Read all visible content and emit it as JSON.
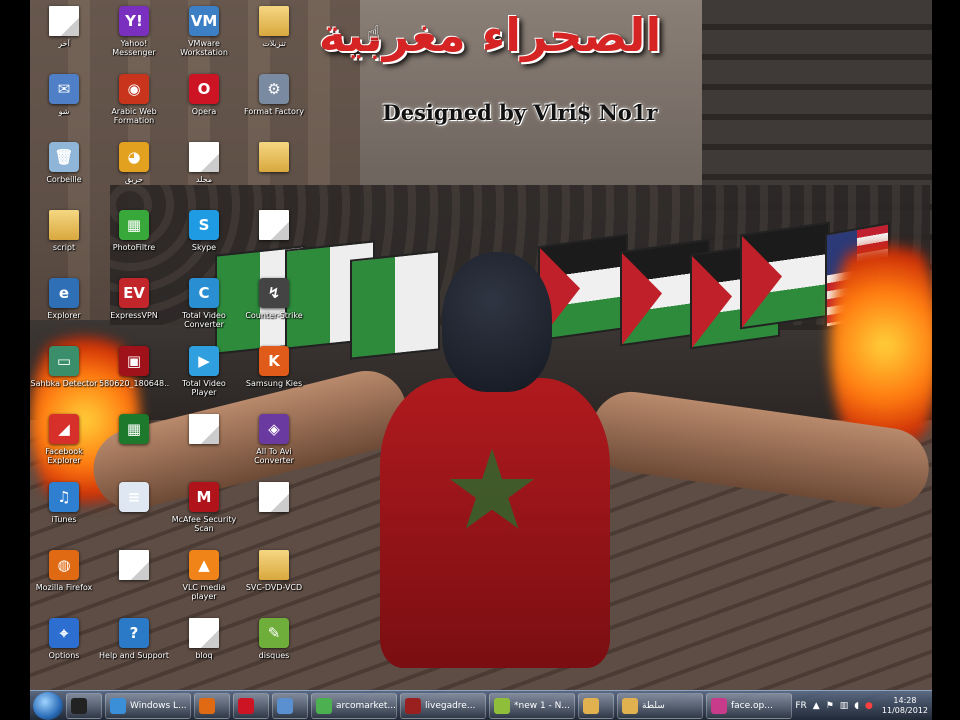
{
  "wallpaper": {
    "title_arabic": "الصحراء مغربية",
    "title_credit": "Designed by Vlri$ No1r"
  },
  "desktop_icons": [
    {
      "label": "آخر",
      "glyph": "",
      "color": "#ffffff",
      "kind": "doc"
    },
    {
      "label": "Yahoo! Messenger",
      "glyph": "Y!",
      "color": "#7b2fbf",
      "kind": "app"
    },
    {
      "label": "VMware Workstation",
      "glyph": "VM",
      "color": "#3c7fc4",
      "kind": "app"
    },
    {
      "label": "تنزيلات",
      "glyph": "",
      "color": "#e0b14e",
      "kind": "folder"
    },
    {
      "label": "شو",
      "glyph": "✉",
      "color": "#4f7fc7",
      "kind": "app"
    },
    {
      "label": "Arabic Web Formation",
      "glyph": "◉",
      "color": "#c8341c",
      "kind": "app"
    },
    {
      "label": "Opera",
      "glyph": "O",
      "color": "#cc1424",
      "kind": "app"
    },
    {
      "label": "Format Factory",
      "glyph": "⚙",
      "color": "#7a8aa0",
      "kind": "app"
    },
    {
      "label": "Corbeille",
      "glyph": "🗑",
      "color": "#8fb6d8",
      "kind": "app"
    },
    {
      "label": "حريق",
      "glyph": "◕",
      "color": "#e2a11e",
      "kind": "app"
    },
    {
      "label": "مجلد",
      "glyph": "",
      "color": "#ffffff",
      "kind": "doc"
    },
    {
      "label": "",
      "glyph": "",
      "color": "#e0b14e",
      "kind": "folder"
    },
    {
      "label": "script",
      "glyph": "",
      "color": "#e0b14e",
      "kind": "folder"
    },
    {
      "label": "PhotoFiltre",
      "glyph": "▦",
      "color": "#38a83a",
      "kind": "app"
    },
    {
      "label": "Skype",
      "glyph": "S",
      "color": "#1e9be2",
      "kind": "app"
    },
    {
      "label": "",
      "glyph": "",
      "color": "#ffffff",
      "kind": "doc"
    },
    {
      "label": "Explorer",
      "glyph": "e",
      "color": "#2f6fb6",
      "kind": "app"
    },
    {
      "label": "ExpressVPN",
      "glyph": "EV",
      "color": "#c2252a",
      "kind": "app"
    },
    {
      "label": "Total Video Converter",
      "glyph": "C",
      "color": "#2a8fd2",
      "kind": "app"
    },
    {
      "label": "Counter-Strike",
      "glyph": "↯",
      "color": "#444444",
      "kind": "app"
    },
    {
      "label": "Sahbka Detector",
      "glyph": "▭",
      "color": "#3a8f6a",
      "kind": "app"
    },
    {
      "label": "580620_180648...",
      "glyph": "▣",
      "color": "#a0121a",
      "kind": "app"
    },
    {
      "label": "Total Video Player",
      "glyph": "▶",
      "color": "#2f9fe0",
      "kind": "app"
    },
    {
      "label": "Samsung Kies",
      "glyph": "K",
      "color": "#e05a1a",
      "kind": "app"
    },
    {
      "label": "Facebook Explorer",
      "glyph": "◢",
      "color": "#d7302a",
      "kind": "app"
    },
    {
      "label": "",
      "glyph": "▦",
      "color": "#1d7a2c",
      "kind": "app"
    },
    {
      "label": "",
      "glyph": "",
      "color": "#ffffff",
      "kind": "doc"
    },
    {
      "label": "All To Avi Converter",
      "glyph": "◈",
      "color": "#6b3aa0",
      "kind": "app"
    },
    {
      "label": "iTunes",
      "glyph": "♫",
      "color": "#2f7fd0",
      "kind": "app"
    },
    {
      "label": "",
      "glyph": "≡",
      "color": "#dfe8f2",
      "kind": "app"
    },
    {
      "label": "McAfee Security Scan",
      "glyph": "M",
      "color": "#b0141a",
      "kind": "app"
    },
    {
      "label": "",
      "glyph": "",
      "color": "#ffffff",
      "kind": "doc"
    },
    {
      "label": "Mozilla Firefox",
      "glyph": "◍",
      "color": "#e06a14",
      "kind": "app"
    },
    {
      "label": "",
      "glyph": "",
      "color": "#ffffff",
      "kind": "doc"
    },
    {
      "label": "VLC media player",
      "glyph": "▲",
      "color": "#f08418",
      "kind": "app"
    },
    {
      "label": "SVC-DVD-VCD",
      "glyph": "",
      "color": "#e0b14e",
      "kind": "folder"
    },
    {
      "label": "Options",
      "glyph": "⌖",
      "color": "#2d6fd0",
      "kind": "app"
    },
    {
      "label": "Help and Support",
      "glyph": "?",
      "color": "#2a7ac8",
      "kind": "app"
    },
    {
      "label": "bloq",
      "glyph": "",
      "color": "#ffffff",
      "kind": "doc"
    },
    {
      "label": "disques",
      "glyph": "✎",
      "color": "#6fae3a",
      "kind": "app"
    }
  ],
  "taskbar": {
    "buttons": [
      {
        "label": "",
        "color": "#222222"
      },
      {
        "label": "Windows L...",
        "color": "#3b8fd8"
      },
      {
        "label": "",
        "color": "#e06a14"
      },
      {
        "label": "",
        "color": "#cc1424"
      },
      {
        "label": "",
        "color": "#5a8fd0"
      },
      {
        "label": "arcomarket...",
        "color": "#4caf50"
      },
      {
        "label": "livegadre...",
        "color": "#9a2020"
      },
      {
        "label": "*new 1 - N...",
        "color": "#8fbf3a"
      },
      {
        "label": "",
        "color": "#e0b14e"
      },
      {
        "label": "سلطة",
        "color": "#e0b14e"
      },
      {
        "label": "face.op...",
        "color": "#c83a8a"
      }
    ],
    "tray_lang": "FR",
    "clock_time": "14:28",
    "clock_date": "11/08/2012"
  }
}
